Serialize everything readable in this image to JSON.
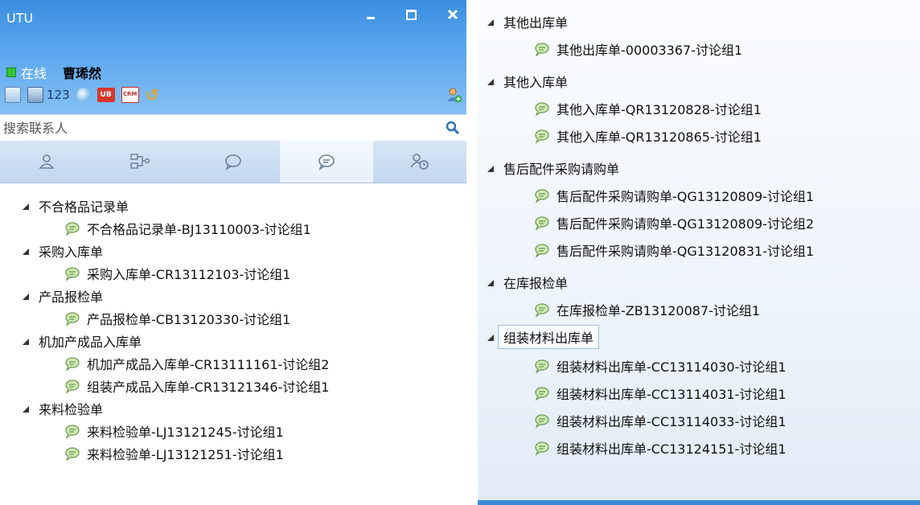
{
  "left_window": {
    "title": "UTU",
    "status": "在线",
    "user_name": "曹琋然",
    "toolbar_count": "123",
    "toolbar_icons": [
      "document-icon",
      "printer-icon",
      "chat-icon",
      "ub-icon",
      "crm-icon",
      "refresh-icon"
    ],
    "search_placeholder": "搜索联系人",
    "tabs": [
      "contacts-icon",
      "organization-icon",
      "chat-bubble-icon",
      "discussion-group-icon",
      "recent-contacts-icon"
    ],
    "active_tab": 3,
    "tree": [
      {
        "group": "不合格品记录单",
        "items": [
          "不合格品记录单-BJ13110003-讨论组1"
        ]
      },
      {
        "group": "采购入库单",
        "items": [
          "采购入库单-CR13112103-讨论组1"
        ]
      },
      {
        "group": "产品报检单",
        "items": [
          "产品报检单-CB13120330-讨论组1"
        ]
      },
      {
        "group": "机加产成品入库单",
        "items": [
          "机加产成品入库单-CR13111161-讨论组2",
          "组装产成品入库单-CR13121346-讨论组1"
        ]
      },
      {
        "group": "来料检验单",
        "items": [
          "来料检验单-LJ13121245-讨论组1",
          "来料检验单-LJ13121251-讨论组1"
        ]
      }
    ]
  },
  "right_window": {
    "tree": [
      {
        "group": "其他出库单",
        "items": [
          "其他出库单-00003367-讨论组1"
        ]
      },
      {
        "group": "其他入库单",
        "items": [
          "其他入库单-QR13120828-讨论组1",
          "其他入库单-QR13120865-讨论组1"
        ]
      },
      {
        "group": "售后配件采购请购单",
        "items": [
          "售后配件采购请购单-QG13120809-讨论组1",
          "售后配件采购请购单-QG13120809-讨论组2",
          "售后配件采购请购单-QG13120831-讨论组1"
        ]
      },
      {
        "group": "在库报检单",
        "items": [
          "在库报检单-ZB13120087-讨论组1"
        ]
      },
      {
        "group": "组装材料出库单",
        "selected": true,
        "items": [
          "组装材料出库单-CC13114030-讨论组1",
          "组装材料出库单-CC13114031-讨论组1",
          "组装材料出库单-CC13114033-讨论组1",
          "组装材料出库单-CC13124151-讨论组1"
        ]
      }
    ]
  },
  "colors": {
    "title_gradient_top": "#3b8ee0",
    "title_gradient_bottom": "#86c0f4",
    "online_green": "#35c43a",
    "bottom_bar": "#3f8ad8"
  }
}
